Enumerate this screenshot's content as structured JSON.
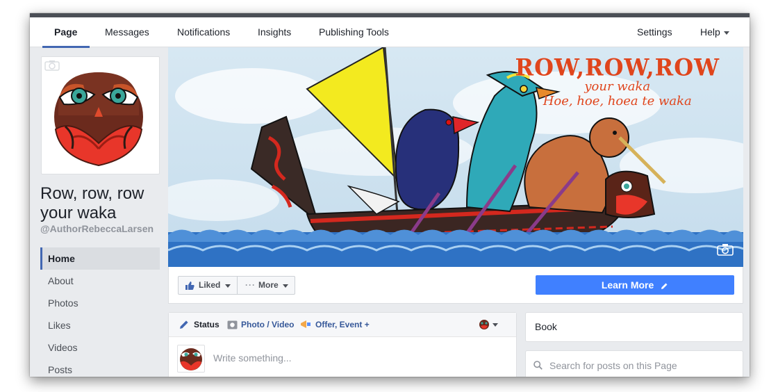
{
  "nav": {
    "tabs": [
      "Page",
      "Messages",
      "Notifications",
      "Insights",
      "Publishing Tools"
    ],
    "settings": "Settings",
    "help": "Help"
  },
  "page": {
    "name": "Row, row, row your waka",
    "handle": "@AuthorRebeccaLarsen"
  },
  "left_nav": [
    "Home",
    "About",
    "Photos",
    "Likes",
    "Videos",
    "Posts"
  ],
  "cover": {
    "line1": "ROW,ROW,ROW",
    "line2": "your waka",
    "line3": "Hoe, hoe, hoea te waka"
  },
  "actions": {
    "liked": "Liked",
    "more": "More",
    "learn_more": "Learn More"
  },
  "composer": {
    "tab_status": "Status",
    "tab_photo": "Photo / Video",
    "tab_offer": "Offer, Event +",
    "placeholder": "Write something..."
  },
  "sidebar": {
    "book": "Book",
    "search_placeholder": "Search for posts on this Page"
  },
  "colors": {
    "accent": "#4267b2",
    "button_blue": "#4080ff",
    "cover_title": "#e0451c"
  }
}
